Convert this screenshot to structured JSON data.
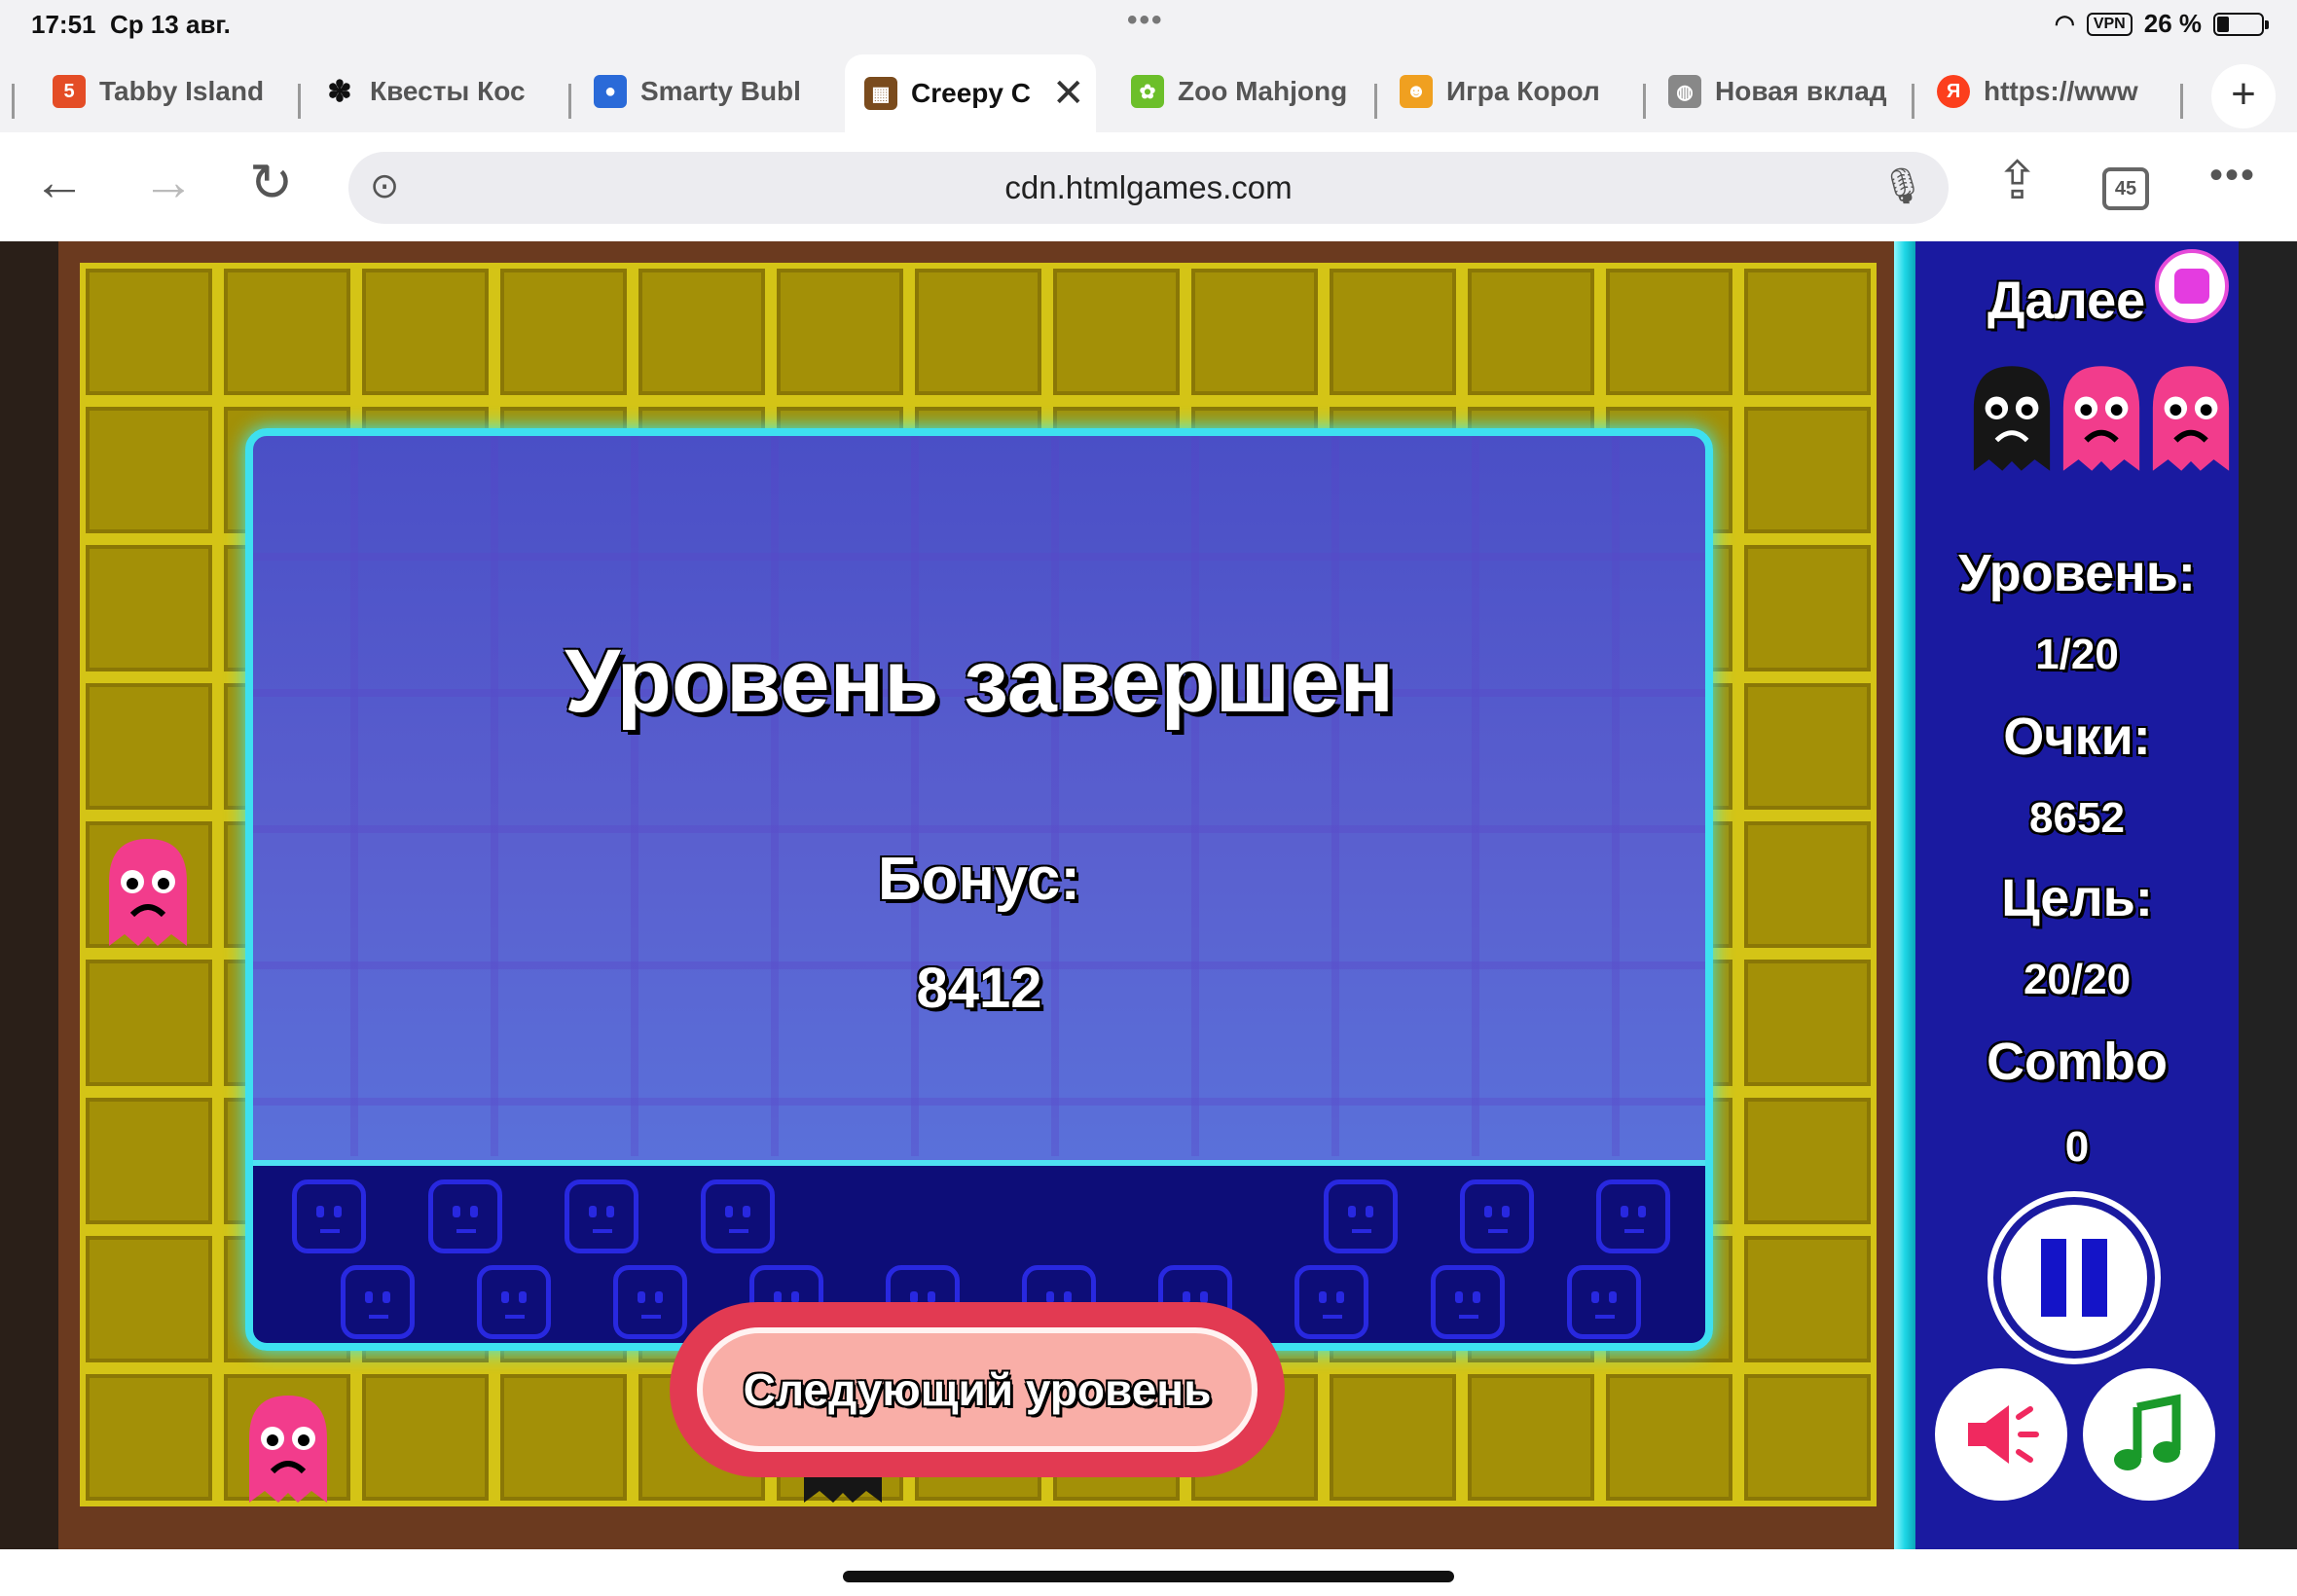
{
  "status_bar": {
    "time": "17:51",
    "date": "Ср 13 авг.",
    "vpn": "VPN",
    "battery": "26 %"
  },
  "tabs": [
    {
      "title": "Tabby Island",
      "favicon": "html5-icon",
      "color": "#e44d26"
    },
    {
      "title": "Квесты Кос",
      "favicon": "paw-icon",
      "color": "#111111"
    },
    {
      "title": "Smarty Bubl",
      "favicon": "bubble-icon",
      "color": "#2a6ad8"
    },
    {
      "title": "Creepy C",
      "favicon": "game-icon",
      "color": "#7a4b1d",
      "active": true
    },
    {
      "title": "Zoo Mahjong",
      "favicon": "zoo-icon",
      "color": "#6cbf2a"
    },
    {
      "title": "Игра Корол",
      "favicon": "frog-icon",
      "color": "#f0a020"
    },
    {
      "title": "Новая вклад",
      "favicon": "globe-icon",
      "color": "#888888"
    },
    {
      "title": "https://www",
      "favicon": "yandex-icon",
      "color": "#fc3f1d"
    }
  ],
  "address_bar": {
    "url": "cdn.htmlgames.com",
    "tab_count": "45"
  },
  "side_panel": {
    "next_label": "Далее",
    "level_label": "Уровень:",
    "level_value": "1/20",
    "score_label": "Очки:",
    "score_value": "8652",
    "goal_label": "Цель:",
    "goal_value": "20/20",
    "combo_label": "Combo",
    "combo_value": "0"
  },
  "dialog": {
    "title": "Уровень завершен",
    "bonus_label": "Бонус:",
    "bonus_value": "8412",
    "next_button": "Следующий уровень"
  },
  "colors": {
    "board_yellow": "#a39007",
    "side_blue": "#1a1aa0",
    "accent_cyan": "#3ee0f0",
    "button_red": "#e23a52",
    "ghost_pink": "#f23c8c",
    "ghost_black": "#111111"
  }
}
